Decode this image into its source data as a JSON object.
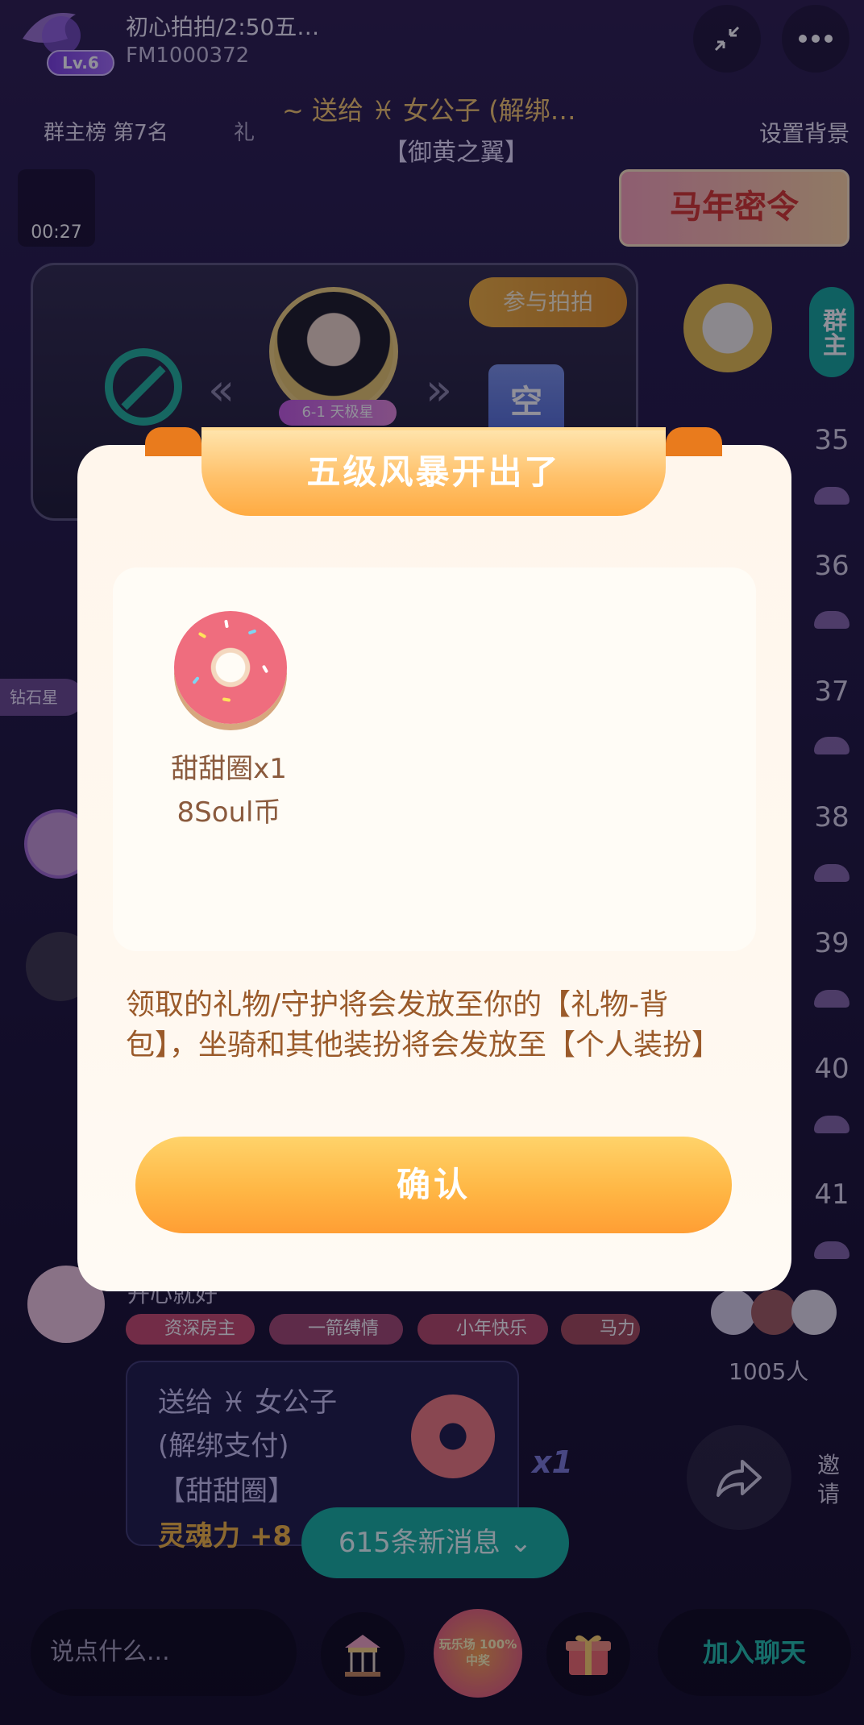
{
  "room": {
    "title": "初心拍拍/2:50五…",
    "id": "FM1000372",
    "level": "Lv.6"
  },
  "header": {
    "rank": "群主榜 第7名",
    "gift_tab": "礼",
    "marquee": "~ 送给 ♓ 女公子 (解绑…",
    "marquee_sub": "【御黄之翼】",
    "set_background": "设置背景",
    "timer": "00:27",
    "banner": "马年密令"
  },
  "stage": {
    "join_button": "参与拍拍",
    "host_tag": "6-1 天极星",
    "empty_seat": "空",
    "group_tag": "群主"
  },
  "side_ranks": [
    "35",
    "36",
    "37",
    "38",
    "39",
    "40",
    "41"
  ],
  "chat": {
    "diamond_tag": "钻石星",
    "user_name": "开心就好",
    "badges": [
      "资深房主",
      "一箭缚情",
      "小年快乐",
      "马力"
    ],
    "gift_line1": "送给 ♓ 女公子",
    "gift_line2": "(解绑支付)",
    "gift_line3": "【甜甜圈】",
    "gift_line4": "灵魂力 +8",
    "gift_count": "x1"
  },
  "online": {
    "count": "1005人",
    "invite": "邀请"
  },
  "new_messages": "615条新消息 ⌄",
  "bottom": {
    "input_placeholder": "说点什么...",
    "lottery": "玩乐场 100%中奖",
    "join_chat": "加入聊天"
  },
  "modal": {
    "title": "五级风暴开出了",
    "reward_name": "甜甜圈x1",
    "reward_value": "8Soul币",
    "notice": "领取的礼物/守护将会发放至你的【礼物-背包】，坐骑和其他装扮将会发放至【个人装扮】",
    "confirm": "确认"
  },
  "colors": {
    "accent_orange": "#ffb745",
    "teal": "#15b29f",
    "notice_text": "#9a5a2a"
  }
}
